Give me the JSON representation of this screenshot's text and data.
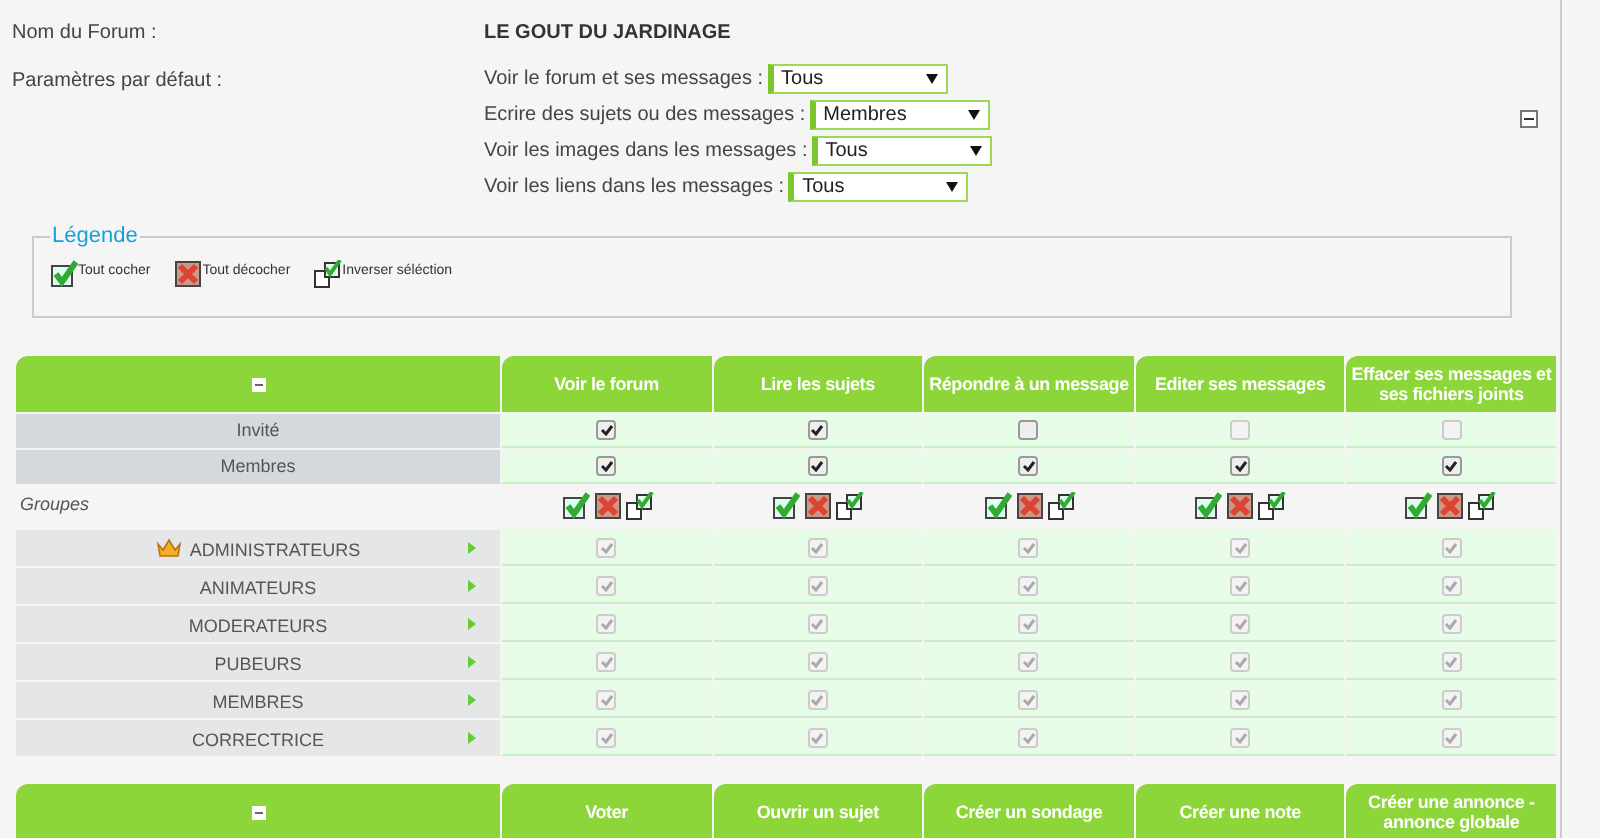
{
  "forum": {
    "name_label": "Nom du Forum :",
    "name": "LE GOUT DU JARDINAGE",
    "defaults_label": "Paramètres par défaut :"
  },
  "defaults": [
    {
      "label": "Voir le forum et ses messages :",
      "value": "Tous"
    },
    {
      "label": "Ecrire des sujets ou des messages :",
      "value": "Membres"
    },
    {
      "label": "Voir les images dans les messages :",
      "value": "Tous"
    },
    {
      "label": "Voir les liens dans les messages :",
      "value": "Tous"
    }
  ],
  "legend": {
    "title": "Légende",
    "items": [
      {
        "kind": "check",
        "label": "Tout cocher"
      },
      {
        "kind": "uncheck",
        "label": "Tout décocher"
      },
      {
        "kind": "invert",
        "label": "Inverser séléction"
      }
    ]
  },
  "tables": [
    {
      "columns": [
        "Voir le forum",
        "Lire les sujets",
        "Répondre à un message",
        "Editer ses messages",
        "Effacer ses messages et ses fichiers joints"
      ],
      "rows": [
        {
          "kind": "user",
          "label": "Invité",
          "cells": [
            {
              "checked": true,
              "disabled": false
            },
            {
              "checked": true,
              "disabled": false
            },
            {
              "checked": false,
              "disabled": false
            },
            {
              "checked": false,
              "disabled": true
            },
            {
              "checked": false,
              "disabled": true
            }
          ]
        },
        {
          "kind": "user",
          "label": "Membres",
          "cells": [
            {
              "checked": true,
              "disabled": false
            },
            {
              "checked": true,
              "disabled": false
            },
            {
              "checked": true,
              "disabled": false
            },
            {
              "checked": true,
              "disabled": false
            },
            {
              "checked": true,
              "disabled": false
            }
          ]
        },
        {
          "kind": "section",
          "label": "Groupes"
        },
        {
          "kind": "group",
          "label": "ADMINISTRATEURS",
          "crown": true,
          "cells": [
            {
              "checked": true,
              "disabled": true
            },
            {
              "checked": true,
              "disabled": true
            },
            {
              "checked": true,
              "disabled": true
            },
            {
              "checked": true,
              "disabled": true
            },
            {
              "checked": true,
              "disabled": true
            }
          ]
        },
        {
          "kind": "group",
          "label": "ANIMATEURS",
          "crown": false,
          "cells": [
            {
              "checked": true,
              "disabled": true
            },
            {
              "checked": true,
              "disabled": true
            },
            {
              "checked": true,
              "disabled": true
            },
            {
              "checked": true,
              "disabled": true
            },
            {
              "checked": true,
              "disabled": true
            }
          ]
        },
        {
          "kind": "group",
          "label": "MODERATEURS",
          "crown": false,
          "cells": [
            {
              "checked": true,
              "disabled": true
            },
            {
              "checked": true,
              "disabled": true
            },
            {
              "checked": true,
              "disabled": true
            },
            {
              "checked": true,
              "disabled": true
            },
            {
              "checked": true,
              "disabled": true
            }
          ]
        },
        {
          "kind": "group",
          "label": "PUBEURS",
          "crown": false,
          "cells": [
            {
              "checked": true,
              "disabled": true
            },
            {
              "checked": true,
              "disabled": true
            },
            {
              "checked": true,
              "disabled": true
            },
            {
              "checked": true,
              "disabled": true
            },
            {
              "checked": true,
              "disabled": true
            }
          ]
        },
        {
          "kind": "group",
          "label": "MEMBRES",
          "crown": false,
          "cells": [
            {
              "checked": true,
              "disabled": true
            },
            {
              "checked": true,
              "disabled": true
            },
            {
              "checked": true,
              "disabled": true
            },
            {
              "checked": true,
              "disabled": true
            },
            {
              "checked": true,
              "disabled": true
            }
          ]
        },
        {
          "kind": "group",
          "label": "CORRECTRICE",
          "crown": false,
          "cells": [
            {
              "checked": true,
              "disabled": true
            },
            {
              "checked": true,
              "disabled": true
            },
            {
              "checked": true,
              "disabled": true
            },
            {
              "checked": true,
              "disabled": true
            },
            {
              "checked": true,
              "disabled": true
            }
          ]
        }
      ]
    },
    {
      "columns": [
        "Voter",
        "Ouvrir un sujet",
        "Créer un sondage",
        "Créer une note",
        "Créer une annonce - annonce globale"
      ]
    }
  ]
}
